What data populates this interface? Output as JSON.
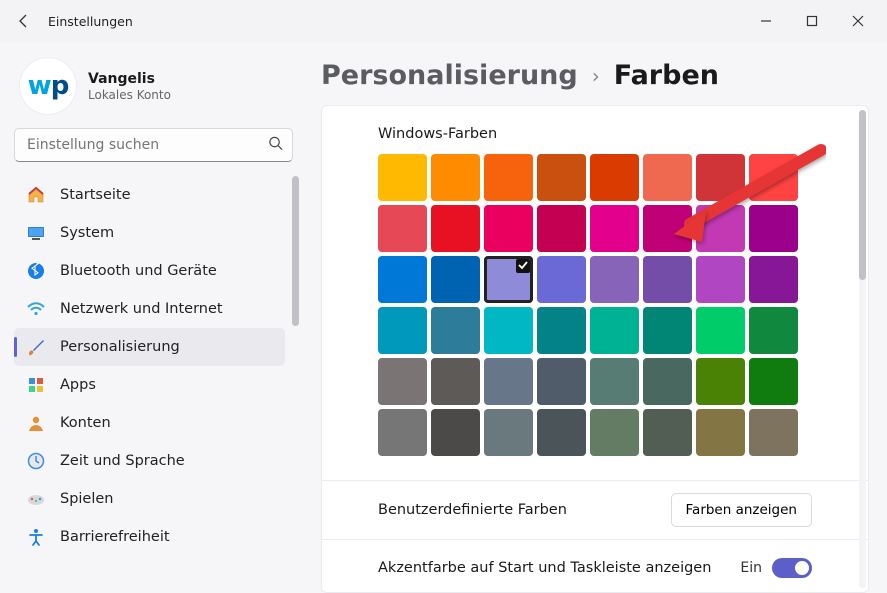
{
  "window": {
    "title": "Einstellungen"
  },
  "account": {
    "name": "Vangelis",
    "sub": "Lokales Konto"
  },
  "search": {
    "placeholder": "Einstellung suchen"
  },
  "sidebar": {
    "items": [
      {
        "icon": "home",
        "label": "Startseite"
      },
      {
        "icon": "system",
        "label": "System"
      },
      {
        "icon": "bt",
        "label": "Bluetooth und Geräte"
      },
      {
        "icon": "wifi",
        "label": "Netzwerk und Internet"
      },
      {
        "icon": "brush",
        "label": "Personalisierung",
        "active": true
      },
      {
        "icon": "apps",
        "label": "Apps"
      },
      {
        "icon": "user",
        "label": "Konten"
      },
      {
        "icon": "time",
        "label": "Zeit und Sprache"
      },
      {
        "icon": "game",
        "label": "Spielen"
      },
      {
        "icon": "access",
        "label": "Barrierefreiheit"
      }
    ]
  },
  "breadcrumb": {
    "parent": "Personalisierung",
    "current": "Farben"
  },
  "colors_section": {
    "title": "Windows-Farben",
    "selected_index": 18,
    "swatches": [
      "#FFB900",
      "#FF8C00",
      "#F7630C",
      "#CA5010",
      "#DA3B01",
      "#EF6950",
      "#D13438",
      "#FF4343",
      "#E74856",
      "#E81123",
      "#EA005E",
      "#C30052",
      "#E3008C",
      "#BF0077",
      "#C239B3",
      "#9A0089",
      "#0078D7",
      "#0063B1",
      "#8E8CD8",
      "#6B69D6",
      "#8764B8",
      "#744DA9",
      "#B146C2",
      "#881798",
      "#0099BC",
      "#2D7D9A",
      "#00B7C3",
      "#038387",
      "#00B294",
      "#018574",
      "#00CC6A",
      "#10893E",
      "#7A7574",
      "#5D5A58",
      "#68768A",
      "#515C6B",
      "#567C73",
      "#486860",
      "#498205",
      "#107C10",
      "#767676",
      "#4C4A48",
      "#69797E",
      "#4A5459",
      "#647C64",
      "#525E54",
      "#847545",
      "#7E735F"
    ]
  },
  "custom_colors": {
    "label": "Benutzerdefinierte Farben",
    "button": "Farben anzeigen"
  },
  "accent_toggle": {
    "label": "Akzentfarbe auf Start und Taskleiste anzeigen",
    "state": "Ein",
    "on": true
  }
}
